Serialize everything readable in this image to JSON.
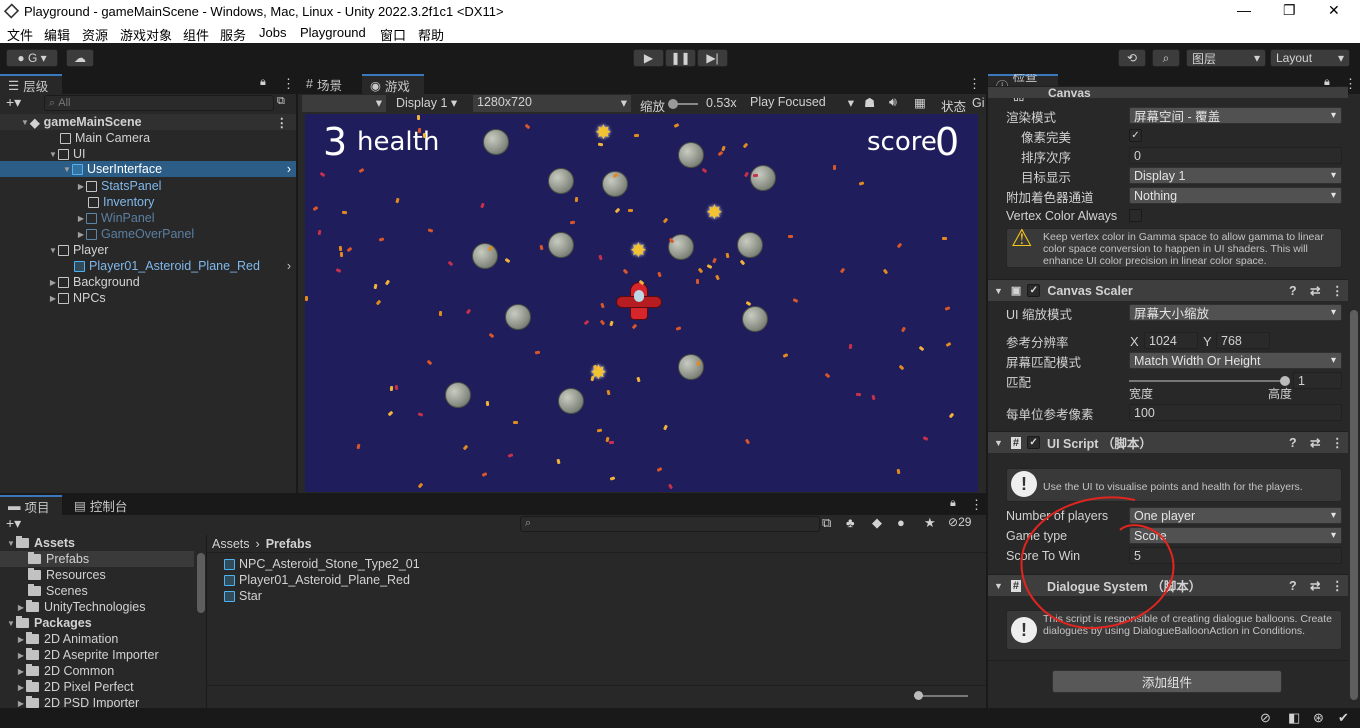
{
  "titlebar": {
    "title": "Playground - gameMainScene - Windows, Mac, Linux - Unity 2022.3.2f1c1 <DX11>"
  },
  "menubar": {
    "items": [
      "文件",
      "编辑",
      "资源",
      "游戏对象",
      "组件",
      "服务",
      "Jobs",
      "Playground",
      "窗口",
      "帮助"
    ]
  },
  "toolbar": {
    "account": "G",
    "layers": "图层",
    "layout": "Layout"
  },
  "hierarchy": {
    "tab": "层级",
    "search_placeholder": "All",
    "items": [
      {
        "label": "gameMainScene"
      },
      {
        "label": "Main Camera"
      },
      {
        "label": "UI"
      },
      {
        "label": "UserInterface"
      },
      {
        "label": "StatsPanel"
      },
      {
        "label": "Inventory"
      },
      {
        "label": "WinPanel"
      },
      {
        "label": "GameOverPanel"
      },
      {
        "label": "Player"
      },
      {
        "label": "Player01_Asteroid_Plane_Red"
      },
      {
        "label": "Background"
      },
      {
        "label": "NPCs"
      }
    ]
  },
  "scene_tabs": {
    "scene": "场景",
    "game": "游戏"
  },
  "game_toolbar": {
    "display": "Display 1",
    "resolution": "1280x720",
    "scale_label": "缩放",
    "scale_value": "0.53x",
    "play_mode": "Play Focused",
    "stats": "状态",
    "gizmos": "Gi"
  },
  "game_view": {
    "health_value": "3",
    "health_label": "health",
    "score_label": "score",
    "score_value": "0",
    "bg_color": "#1f1d5c"
  },
  "project": {
    "tab_project": "项目",
    "tab_console": "控制台",
    "count": "29",
    "tree": [
      {
        "label": "Assets"
      },
      {
        "label": "Prefabs"
      },
      {
        "label": "Resources"
      },
      {
        "label": "Scenes"
      },
      {
        "label": "UnityTechnologies"
      },
      {
        "label": "Packages"
      },
      {
        "label": "2D Animation"
      },
      {
        "label": "2D Aseprite Importer"
      },
      {
        "label": "2D Common"
      },
      {
        "label": "2D Pixel Perfect"
      },
      {
        "label": "2D PSD Importer"
      }
    ],
    "breadcrumb_root": "Assets",
    "breadcrumb_current": "Prefabs",
    "files": [
      {
        "label": "NPC_Asteroid_Stone_Type2_01"
      },
      {
        "label": "Player01_Asteroid_Plane_Red"
      },
      {
        "label": "Star"
      }
    ]
  },
  "inspector": {
    "tab": "检查器",
    "canvas_header": "Canvas",
    "render_mode_label": "渲染模式",
    "render_mode_value": "屏幕空间 - 覆盖",
    "pixel_perfect_label": "像素完美",
    "sort_order_label": "排序次序",
    "sort_order_value": "0",
    "target_display_label": "目标显示",
    "target_display_value": "Display 1",
    "shader_channels_label": "附加着色器通道",
    "shader_channels_value": "Nothing",
    "vertex_color_label": "Vertex Color Always",
    "vertex_help": "Keep vertex color in Gamma space to allow gamma to linear color space conversion to happen in UI shaders. This will enhance UI color precision in linear color space.",
    "canvas_scaler_header": "Canvas Scaler",
    "ui_scale_mode_label": "UI 缩放模式",
    "ui_scale_mode_value": "屏幕大小缩放",
    "ref_res_label": "参考分辨率",
    "ref_x_label": "X",
    "ref_x_value": "1024",
    "ref_y_label": "Y",
    "ref_y_value": "768",
    "match_mode_label": "屏幕匹配模式",
    "match_mode_value": "Match Width Or Height",
    "match_label": "匹配",
    "match_value": "1",
    "match_fraction": 1,
    "width_label": "宽度",
    "height_label": "高度",
    "ppu_label": "每单位参考像素",
    "ppu_value": "100",
    "ui_script_header": "UI Script （脚本）",
    "ui_script_help": "Use the UI to visualise points and health for the players.",
    "num_players_label": "Number of players",
    "num_players_value": "One player",
    "game_type_label": "Game type",
    "game_type_value": "Score",
    "score_to_win_label": "Score To Win",
    "score_to_win_value": "5",
    "dialogue_header": "Dialogue System （脚本）",
    "dialogue_help": "This script is responsible of creating dialogue balloons. Create dialogues by using DialogueBalloonAction in Conditions.",
    "add_component": "添加组件"
  }
}
